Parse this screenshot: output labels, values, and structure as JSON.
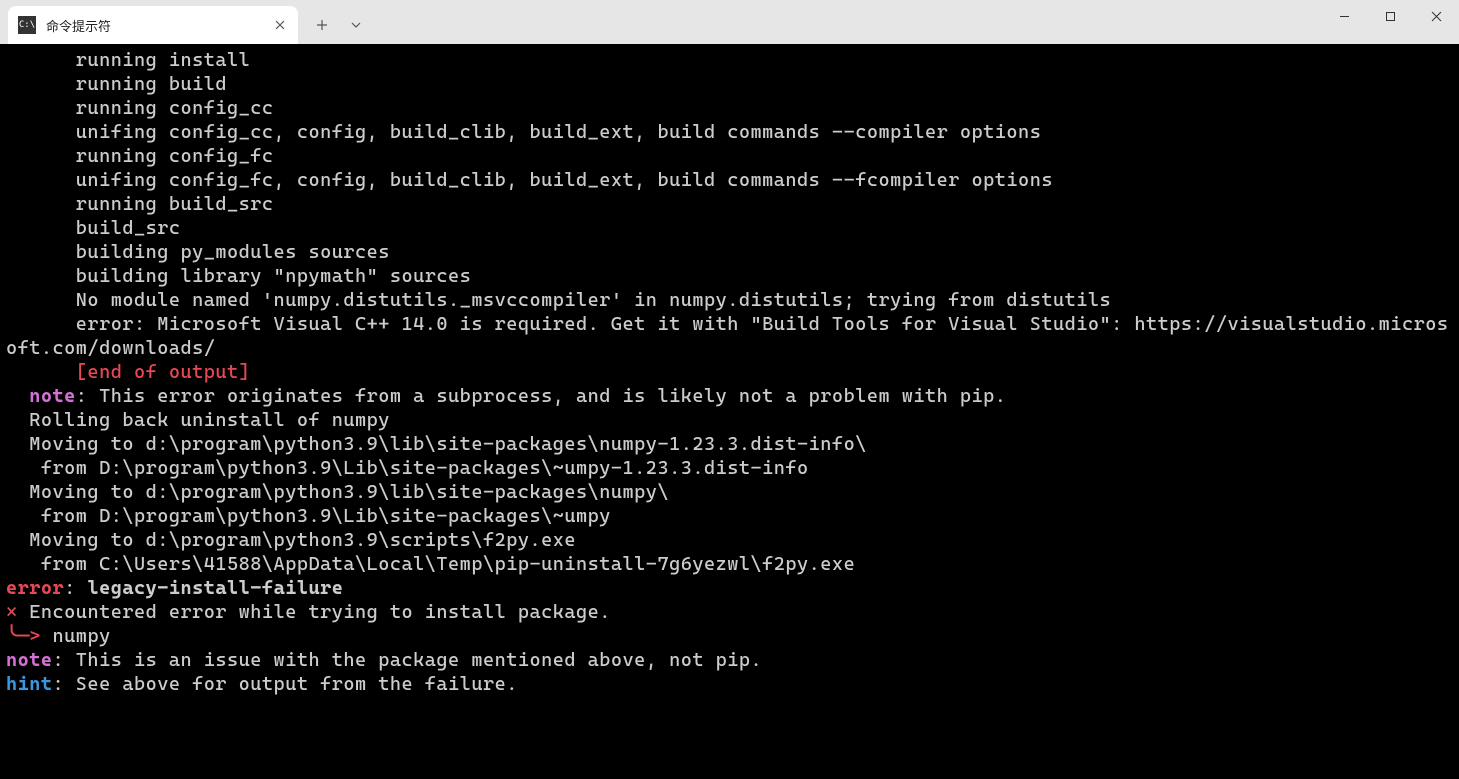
{
  "tab": {
    "title": "命令提示符",
    "icon_text": "C:\\"
  },
  "terminal": {
    "lines": [
      {
        "indent": 6,
        "parts": [
          {
            "color": "white",
            "text": "running install"
          }
        ]
      },
      {
        "indent": 6,
        "parts": [
          {
            "color": "white",
            "text": "running build"
          }
        ]
      },
      {
        "indent": 6,
        "parts": [
          {
            "color": "white",
            "text": "running config_cc"
          }
        ]
      },
      {
        "indent": 6,
        "parts": [
          {
            "color": "white",
            "text": "unifing config_cc, config, build_clib, build_ext, build commands --compiler options"
          }
        ]
      },
      {
        "indent": 6,
        "parts": [
          {
            "color": "white",
            "text": "running config_fc"
          }
        ]
      },
      {
        "indent": 6,
        "parts": [
          {
            "color": "white",
            "text": "unifing config_fc, config, build_clib, build_ext, build commands --fcompiler options"
          }
        ]
      },
      {
        "indent": 6,
        "parts": [
          {
            "color": "white",
            "text": "running build_src"
          }
        ]
      },
      {
        "indent": 6,
        "parts": [
          {
            "color": "white",
            "text": "build_src"
          }
        ]
      },
      {
        "indent": 6,
        "parts": [
          {
            "color": "white",
            "text": "building py_modules sources"
          }
        ]
      },
      {
        "indent": 6,
        "parts": [
          {
            "color": "white",
            "text": "building library \"npymath\" sources"
          }
        ]
      },
      {
        "indent": 6,
        "parts": [
          {
            "color": "white",
            "text": "No module named 'numpy.distutils._msvccompiler' in numpy.distutils; trying from distutils"
          }
        ]
      },
      {
        "indent": 6,
        "parts": [
          {
            "color": "white",
            "text": "error: Microsoft Visual C++ 14.0 is required. Get it with \"Build Tools for Visual Studio\": https://visualstudio.microsoft.com/downloads/"
          }
        ]
      },
      {
        "indent": 6,
        "parts": [
          {
            "color": "red",
            "text": "[end of output]"
          }
        ]
      },
      {
        "indent": 0,
        "parts": [
          {
            "color": "white",
            "text": ""
          }
        ]
      },
      {
        "indent": 2,
        "parts": [
          {
            "color": "magenta",
            "text": "note",
            "bold": true
          },
          {
            "color": "white",
            "text": ": This error originates from a subprocess, and is likely not a problem with pip."
          }
        ]
      },
      {
        "indent": 2,
        "parts": [
          {
            "color": "white",
            "text": "Rolling back uninstall of numpy"
          }
        ]
      },
      {
        "indent": 2,
        "parts": [
          {
            "color": "white",
            "text": "Moving to d:\\program\\python3.9\\lib\\site-packages\\numpy-1.23.3.dist-info\\"
          }
        ]
      },
      {
        "indent": 2,
        "parts": [
          {
            "color": "white",
            "text": " from D:\\program\\python3.9\\Lib\\site-packages\\~umpy-1.23.3.dist-info"
          }
        ]
      },
      {
        "indent": 2,
        "parts": [
          {
            "color": "white",
            "text": "Moving to d:\\program\\python3.9\\lib\\site-packages\\numpy\\"
          }
        ]
      },
      {
        "indent": 2,
        "parts": [
          {
            "color": "white",
            "text": " from D:\\program\\python3.9\\Lib\\site-packages\\~umpy"
          }
        ]
      },
      {
        "indent": 2,
        "parts": [
          {
            "color": "white",
            "text": "Moving to d:\\program\\python3.9\\scripts\\f2py.exe"
          }
        ]
      },
      {
        "indent": 2,
        "parts": [
          {
            "color": "white",
            "text": " from C:\\Users\\41588\\AppData\\Local\\Temp\\pip-uninstall-7g6yezwl\\f2py.exe"
          }
        ]
      },
      {
        "indent": 0,
        "parts": [
          {
            "color": "red",
            "text": "error",
            "bold": true
          },
          {
            "color": "white",
            "text": ": "
          },
          {
            "color": "white",
            "text": "legacy-install-failure",
            "bold": true
          }
        ]
      },
      {
        "indent": 0,
        "parts": [
          {
            "color": "white",
            "text": ""
          }
        ]
      },
      {
        "indent": 0,
        "parts": [
          {
            "color": "red",
            "text": "×"
          },
          {
            "color": "white",
            "text": " Encountered error while trying to install package."
          }
        ]
      },
      {
        "indent": 0,
        "parts": [
          {
            "color": "red",
            "text": "╰─>"
          },
          {
            "color": "white",
            "text": " numpy"
          }
        ]
      },
      {
        "indent": 0,
        "parts": [
          {
            "color": "white",
            "text": ""
          }
        ]
      },
      {
        "indent": 0,
        "parts": [
          {
            "color": "magenta",
            "text": "note",
            "bold": true
          },
          {
            "color": "white",
            "text": ": This is an issue with the package mentioned above, not pip."
          }
        ]
      },
      {
        "indent": 0,
        "parts": [
          {
            "color": "cyan",
            "text": "hint",
            "bold": true
          },
          {
            "color": "white",
            "text": ": See above for output from the failure."
          }
        ]
      }
    ]
  }
}
